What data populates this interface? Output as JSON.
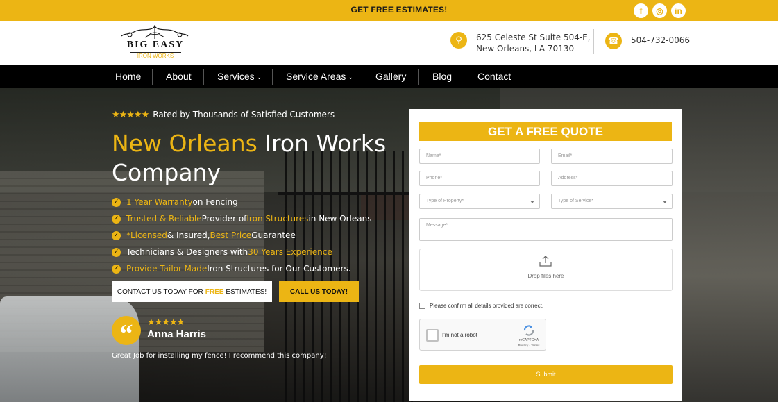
{
  "topbar": {
    "cta": "GET FREE ESTIMATES!",
    "social": [
      {
        "icon": "facebook-icon",
        "glyph": "f"
      },
      {
        "icon": "instagram-icon",
        "glyph": "◎"
      },
      {
        "icon": "linkedin-icon",
        "glyph": "in"
      }
    ]
  },
  "header": {
    "logo_line1": "BIG EASY",
    "logo_line2": "IRON WORKS",
    "address_line1": "625 Celeste St Suite 504-E,",
    "address_line2": "New Orleans, LA 70130",
    "phone": "504-732-0066"
  },
  "nav": {
    "items": [
      "Home",
      "About",
      "Services",
      "Service Areas",
      "Gallery",
      "Blog",
      "Contact"
    ]
  },
  "hero": {
    "stars": "★★★★★",
    "rated": "Rated by Thousands of Satisfied Customers",
    "title_gold": "New Orleans",
    "title_white_1": " Iron Works",
    "title_white_2": "Company",
    "bullets": [
      {
        "hl1": "1 Year Warranty",
        "t1": " on Fencing",
        "hl2": "",
        "t2": ""
      },
      {
        "hl1": "Trusted & Reliable",
        "t1": " Provider of ",
        "hl2": "Iron Structures",
        "t2": " in New Orleans"
      },
      {
        "hl1": "*Licensed",
        "t1": " & Insured, ",
        "hl2": "Best Price",
        "t2": " Guarantee"
      },
      {
        "hl1": "",
        "t1": "Technicians & Designers with ",
        "hl2": "30 Years Experience",
        "t2": ""
      },
      {
        "hl1": "Provide Tailor-Made",
        "t1": " Iron Structures for Our Customers.",
        "hl2": "",
        "t2": ""
      }
    ],
    "btn_contact_pre": "CONTACT US TODAY FOR",
    "btn_contact_hl": "FREE",
    "btn_contact_post": "ESTIMATES!",
    "btn_call": "CALL US TODAY!",
    "review_stars": "★★★★★",
    "review_name": "Anna Harris",
    "review_text": "Great Job for installing my fence! I recommend this company!"
  },
  "form": {
    "title": "GET A FREE QUOTE",
    "name_ph": "Name*",
    "email_ph": "Email*",
    "phone_ph": "Phone*",
    "address_ph": "Address*",
    "property_ph": "Type of Property*",
    "service_ph": "Type of Service*",
    "message_ph": "Message*",
    "drop_text": "Drop files here",
    "confirm": "Please confirm all details provided are correct.",
    "captcha_label": "I'm not a robot",
    "captcha_brand": "reCAPTCHA",
    "captcha_terms": "Privacy - Terms",
    "submit": "Submit"
  },
  "colors": {
    "accent": "#ecb514",
    "nav_bg": "#000000"
  }
}
